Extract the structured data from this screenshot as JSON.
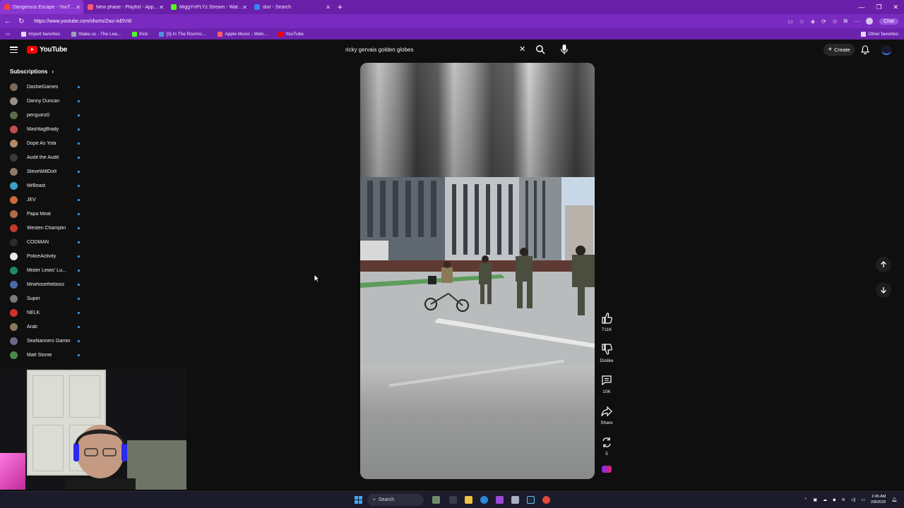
{
  "browser": {
    "tabs": [
      {
        "label": "Dangerous Escape - YouTube",
        "active": true,
        "favicon_color": "#ff3b3b"
      },
      {
        "label": "New phase - Playlist - Apple Music",
        "active": false,
        "favicon_color": "#ff5a6e"
      },
      {
        "label": "MiggYnPLYz Stream - Watch Live",
        "active": false,
        "favicon_color": "#53fc18"
      },
      {
        "label": "dior - Search",
        "active": false,
        "favicon_color": "#3b82f6"
      }
    ],
    "new_tab": "+",
    "url": "https://www.youtube.com/shorts/Zwz-ixElVI8",
    "chat_label": "Chat",
    "bookmarks": [
      {
        "label": "Import favorites",
        "icon_color": "#e6d4ff"
      },
      {
        "label": "Stake.us - The Lea...",
        "icon_color": "#9aa3b5"
      },
      {
        "label": "Kick",
        "icon_color": "#53fc18"
      },
      {
        "label": "[3] In The Rooms:...",
        "icon_color": "#4a90e2"
      },
      {
        "label": "Apple Music - Web...",
        "icon_color": "#ff5a6e"
      },
      {
        "label": "YouTube",
        "icon_color": "#ff0000"
      }
    ],
    "other_favorites": "Other favorites"
  },
  "youtube": {
    "logo_text": "YouTube",
    "search_value": "ricky gervais golden globes",
    "create_label": "Create",
    "subscriptions_title": "Subscriptions",
    "subscriptions": [
      {
        "name": "DashieGames",
        "color": "#7a6a5a"
      },
      {
        "name": "Danny Duncan",
        "color": "#9a8f86"
      },
      {
        "name": "penguinz0",
        "color": "#5c6b4a"
      },
      {
        "name": "MashtagBrady",
        "color": "#c0504d"
      },
      {
        "name": "Dope As Yola",
        "color": "#b08a6a"
      },
      {
        "name": "Audit the Audit",
        "color": "#3a3a3a"
      },
      {
        "name": "SteveWillDoIt",
        "color": "#8c7a6a"
      },
      {
        "name": "MrBeast",
        "color": "#3aa0c8"
      },
      {
        "name": "JEV",
        "color": "#c86a3a"
      },
      {
        "name": "Papa Meat",
        "color": "#b06a4a"
      },
      {
        "name": "Westen Champlin",
        "color": "#c0392b"
      },
      {
        "name": "CODMAN",
        "color": "#2b2b2b"
      },
      {
        "name": "PoliceActivity",
        "color": "#e8e8e8"
      },
      {
        "name": "Mister Lewis' Lu...",
        "color": "#1e8a6a"
      },
      {
        "name": "Mrwhosetheboss",
        "color": "#4a6aa8"
      },
      {
        "name": "Super",
        "color": "#7a7a7a"
      },
      {
        "name": "NELK",
        "color": "#d03030"
      },
      {
        "name": "Arab",
        "color": "#8a7a5a"
      },
      {
        "name": "SeaNanners Gamin...",
        "color": "#6a6a8a"
      },
      {
        "name": "Matt Stonie",
        "color": "#4a8a4a"
      }
    ],
    "actions": {
      "likes": "711K",
      "dislike": "Dislike",
      "comments": "10K",
      "share": "Share",
      "remix": "5"
    }
  },
  "taskbar": {
    "search_placeholder": "Search",
    "time": "2:45 AM",
    "date": "2/8/2026"
  }
}
